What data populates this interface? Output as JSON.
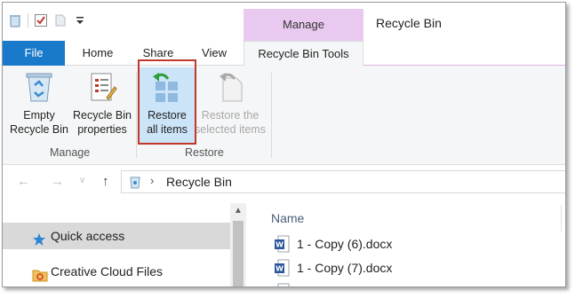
{
  "window": {
    "title": "Recycle Bin"
  },
  "contextual_tab": {
    "label": "Manage"
  },
  "tabs": [
    {
      "label": "File"
    },
    {
      "label": "Home"
    },
    {
      "label": "Share"
    },
    {
      "label": "View"
    },
    {
      "label": "Recycle Bin Tools"
    }
  ],
  "ribbon": {
    "manage_group": {
      "label": "Manage",
      "empty": {
        "line1": "Empty",
        "line2": "Recycle Bin"
      },
      "properties": {
        "line1": "Recycle Bin",
        "line2": "properties"
      }
    },
    "restore_group": {
      "label": "Restore",
      "restore_all": {
        "line1": "Restore",
        "line2": "all items"
      },
      "restore_selected": {
        "line1": "Restore the",
        "line2": "selected items"
      }
    }
  },
  "address": {
    "path": "Recycle Bin"
  },
  "nav": {
    "items": [
      {
        "label": "Quick access"
      },
      {
        "label": "Creative Cloud Files"
      }
    ]
  },
  "files": {
    "column_name": "Name",
    "items": [
      {
        "name": "1 - Copy (6).docx"
      },
      {
        "name": "1 - Copy (7).docx"
      }
    ]
  },
  "colors": {
    "file_tab": "#1979ca",
    "manage_tab": "#e9c9ef",
    "highlight_box": "#c0392b",
    "selection": "#d9d9d9"
  }
}
